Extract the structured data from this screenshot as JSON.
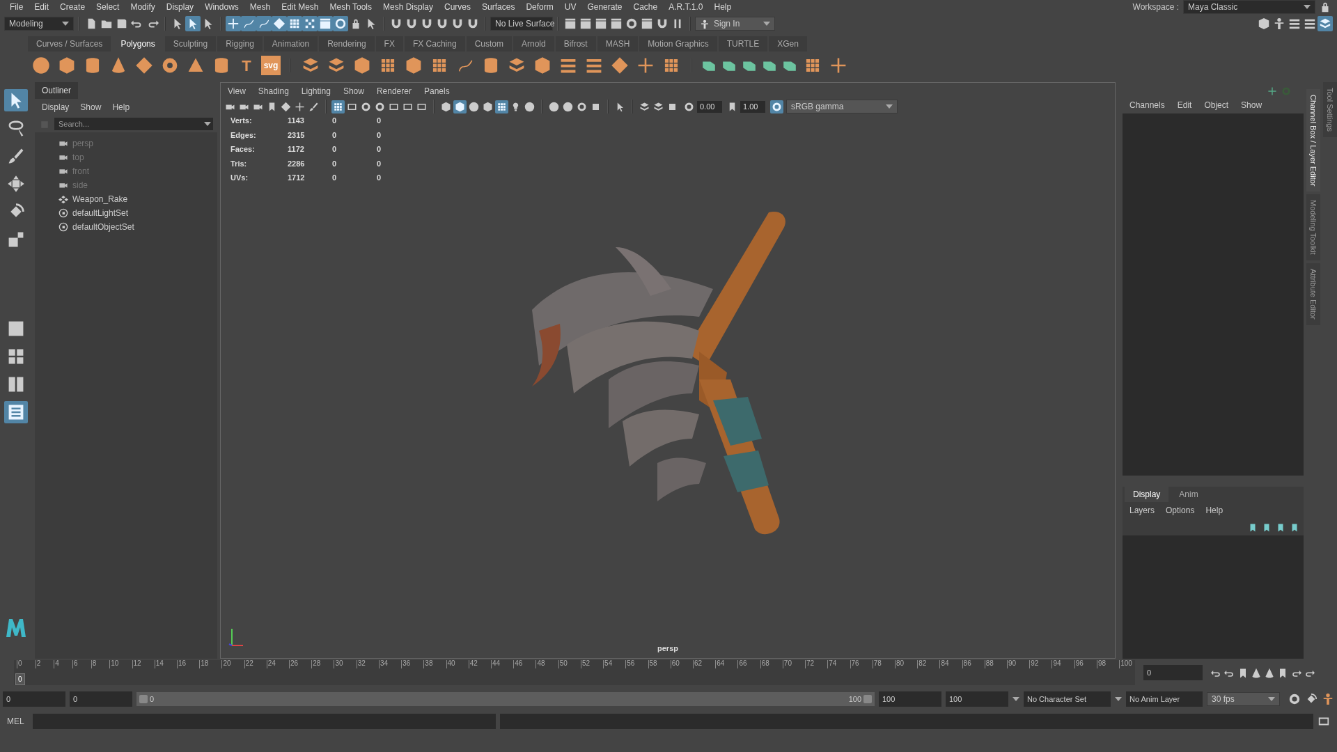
{
  "menu_bar": [
    "File",
    "Edit",
    "Create",
    "Select",
    "Modify",
    "Display",
    "Windows",
    "Mesh",
    "Edit Mesh",
    "Mesh Tools",
    "Mesh Display",
    "Curves",
    "Surfaces",
    "Deform",
    "UV",
    "Generate",
    "Cache",
    "A.R.T.1.0",
    "Help"
  ],
  "workspace": {
    "label": "Workspace :",
    "value": "Maya Classic"
  },
  "status_line": {
    "mode": "Modeling",
    "live_surface": "No Live Surface",
    "sign_in": "Sign In",
    "groups": [
      [
        {
          "kind": "page",
          "selected": false
        },
        {
          "kind": "folder",
          "selected": false
        },
        {
          "kind": "disk",
          "selected": false
        },
        {
          "kind": "undo",
          "selected": false
        },
        {
          "kind": "redo",
          "selected": false
        }
      ],
      [
        {
          "kind": "arrow",
          "selected": false
        },
        {
          "kind": "arrow",
          "selected": true
        },
        {
          "kind": "arrow",
          "selected": false
        }
      ],
      [
        {
          "kind": "cross",
          "selected": true
        },
        {
          "kind": "curve",
          "selected": true
        },
        {
          "kind": "curve",
          "selected": true
        },
        {
          "kind": "diamond",
          "selected": true
        },
        {
          "kind": "grid",
          "selected": true
        },
        {
          "kind": "dots",
          "selected": true
        },
        {
          "kind": "clapper",
          "selected": true
        },
        {
          "kind": "help",
          "selected": true
        },
        {
          "kind": "lock",
          "selected": false
        },
        {
          "kind": "arrow",
          "selected": false
        }
      ],
      [
        {
          "kind": "magnet",
          "selected": false
        },
        {
          "kind": "magnet",
          "selected": false
        },
        {
          "kind": "magnet",
          "selected": false
        },
        {
          "kind": "magnet",
          "selected": false
        },
        {
          "kind": "magnet",
          "selected": false
        },
        {
          "kind": "magnet",
          "selected": false
        }
      ]
    ],
    "render_icons": [
      {
        "kind": "clapper",
        "selected": false
      },
      {
        "kind": "clapper",
        "selected": false
      },
      {
        "kind": "clapper",
        "selected": false
      },
      {
        "kind": "clapper",
        "selected": false
      },
      {
        "kind": "circle",
        "selected": false
      },
      {
        "kind": "clapper",
        "selected": false
      },
      {
        "kind": "magnet",
        "selected": false
      },
      {
        "kind": "pause",
        "selected": false
      }
    ],
    "right_icons": [
      {
        "kind": "cube",
        "selected": false
      },
      {
        "kind": "person",
        "selected": false
      },
      {
        "kind": "list",
        "selected": false
      },
      {
        "kind": "list",
        "selected": false
      },
      {
        "kind": "layers",
        "selected": true
      }
    ]
  },
  "shelf_tabs": [
    {
      "label": "Curves / Surfaces",
      "selected": false
    },
    {
      "label": "Polygons",
      "selected": true
    },
    {
      "label": "Sculpting",
      "selected": false
    },
    {
      "label": "Rigging",
      "selected": false
    },
    {
      "label": "Animation",
      "selected": false
    },
    {
      "label": "Rendering",
      "selected": false
    },
    {
      "label": "FX",
      "selected": false
    },
    {
      "label": "FX Caching",
      "selected": false
    },
    {
      "label": "Custom",
      "selected": false
    },
    {
      "label": "Arnold",
      "selected": false
    },
    {
      "label": "Bifrost",
      "selected": false
    },
    {
      "label": "MASH",
      "selected": false
    },
    {
      "label": "Motion Graphics",
      "selected": false
    },
    {
      "label": "TURTLE",
      "selected": false
    },
    {
      "label": "XGen",
      "selected": false
    }
  ],
  "shelf_icons": [
    {
      "kind": "sphere"
    },
    {
      "kind": "cube"
    },
    {
      "kind": "cylinder"
    },
    {
      "kind": "cone"
    },
    {
      "kind": "diamond"
    },
    {
      "kind": "torus"
    },
    {
      "kind": "pyramid"
    },
    {
      "kind": "cylinder"
    },
    {
      "kind": "text",
      "text": "T"
    },
    {
      "kind": "text",
      "text": "svg"
    },
    {
      "kind": "gap"
    },
    {
      "kind": "layers"
    },
    {
      "kind": "layers"
    },
    {
      "kind": "cube"
    },
    {
      "kind": "grid"
    },
    {
      "kind": "cube"
    },
    {
      "kind": "grid"
    },
    {
      "kind": "curve"
    },
    {
      "kind": "cylinder"
    },
    {
      "kind": "layers"
    },
    {
      "kind": "cube"
    },
    {
      "kind": "list"
    },
    {
      "kind": "list"
    },
    {
      "kind": "diamond"
    },
    {
      "kind": "cross"
    },
    {
      "kind": "grid"
    },
    {
      "kind": "gap"
    },
    {
      "kind": "uv"
    },
    {
      "kind": "uv"
    },
    {
      "kind": "uv"
    },
    {
      "kind": "uv"
    },
    {
      "kind": "uv"
    },
    {
      "kind": "grid"
    },
    {
      "kind": "cross"
    }
  ],
  "tools": [
    {
      "kind": "arrow",
      "selected": true
    },
    {
      "kind": "lasso",
      "selected": false
    },
    {
      "kind": "brush",
      "selected": false
    },
    {
      "kind": "move",
      "selected": false
    },
    {
      "kind": "rotate",
      "selected": false
    },
    {
      "kind": "scale",
      "selected": false
    }
  ],
  "layouts": [
    {
      "kind": "single",
      "selected": false
    },
    {
      "kind": "quad",
      "selected": false
    },
    {
      "kind": "split",
      "selected": false
    },
    {
      "kind": "outliner",
      "selected": true
    }
  ],
  "outliner": {
    "title": "Outliner",
    "menu": [
      "Display",
      "Show",
      "Help"
    ],
    "search": {
      "placeholder": "Search..."
    },
    "items": [
      {
        "label": "persp",
        "kind": "camera",
        "dimmed": true
      },
      {
        "label": "top",
        "kind": "camera",
        "dimmed": true
      },
      {
        "label": "front",
        "kind": "camera",
        "dimmed": true
      },
      {
        "label": "side",
        "kind": "camera",
        "dimmed": true
      },
      {
        "label": "Weapon_Rake",
        "kind": "transform",
        "dimmed": false
      },
      {
        "label": "defaultLightSet",
        "kind": "set",
        "dimmed": false
      },
      {
        "label": "defaultObjectSet",
        "kind": "set",
        "dimmed": false
      }
    ]
  },
  "viewport": {
    "menu": [
      "View",
      "Shading",
      "Lighting",
      "Show",
      "Renderer",
      "Panels"
    ],
    "toolbar": [
      {
        "kind": "camera",
        "selected": false
      },
      {
        "kind": "camera",
        "selected": false
      },
      {
        "kind": "camera",
        "selected": false
      },
      {
        "kind": "bookmark",
        "selected": false
      },
      {
        "kind": "diamond",
        "selected": false
      },
      {
        "kind": "cross",
        "selected": false
      },
      {
        "kind": "brush",
        "selected": false
      },
      {
        "kind": "sep"
      },
      {
        "kind": "grid",
        "selected": true
      },
      {
        "kind": "film",
        "selected": false
      },
      {
        "kind": "circle",
        "selected": false
      },
      {
        "kind": "circle",
        "selected": false
      },
      {
        "kind": "film",
        "selected": false
      },
      {
        "kind": "film",
        "selected": false
      },
      {
        "kind": "film",
        "selected": false
      },
      {
        "kind": "sep"
      },
      {
        "kind": "cube",
        "selected": false
      },
      {
        "kind": "cube",
        "selected": true
      },
      {
        "kind": "sphere",
        "selected": false
      },
      {
        "kind": "cube",
        "selected": false
      },
      {
        "kind": "grid",
        "selected": true
      },
      {
        "kind": "bulb",
        "selected": false
      },
      {
        "kind": "sphere",
        "selected": false
      },
      {
        "kind": "sep"
      },
      {
        "kind": "sphere",
        "selected": false
      },
      {
        "kind": "sphere",
        "selected": false
      },
      {
        "kind": "circle",
        "selected": false
      },
      {
        "kind": "square",
        "selected": false
      },
      {
        "kind": "sep"
      },
      {
        "kind": "arrow",
        "selected": false
      },
      {
        "kind": "sep"
      },
      {
        "kind": "layers",
        "selected": false
      },
      {
        "kind": "layers",
        "selected": false
      },
      {
        "kind": "square",
        "selected": false
      }
    ],
    "exposure": "0.00",
    "gamma": "1.00",
    "color_space": "sRGB gamma",
    "hud": [
      {
        "label": "Verts:",
        "values": [
          "1143",
          "0",
          "0"
        ]
      },
      {
        "label": "Edges:",
        "values": [
          "2315",
          "0",
          "0"
        ]
      },
      {
        "label": "Faces:",
        "values": [
          "1172",
          "0",
          "0"
        ]
      },
      {
        "label": "Tris:",
        "values": [
          "2286",
          "0",
          "0"
        ]
      },
      {
        "label": "UVs:",
        "values": [
          "1712",
          "0",
          "0"
        ]
      }
    ],
    "camera": "persp",
    "model": {
      "kind": "picture"
    }
  },
  "channel_box": {
    "menu": [
      "Channels",
      "Edit",
      "Object",
      "Show"
    ]
  },
  "layer_editor": {
    "tabs": [
      {
        "label": "Display",
        "selected": true
      },
      {
        "label": "Anim",
        "selected": false
      }
    ],
    "menu": [
      "Layers",
      "Options",
      "Help"
    ]
  },
  "side_tabs": [
    {
      "label": "Channel Box / Layer Editor",
      "selected": true
    },
    {
      "label": "Modeling Toolkit",
      "selected": false
    },
    {
      "label": "Attribute Editor",
      "selected": false
    }
  ],
  "side_tabs_2": [
    {
      "label": "Tool Settings",
      "selected": false
    }
  ],
  "timeline": {
    "ticks": [
      "0",
      "2",
      "4",
      "6",
      "8",
      "10",
      "12",
      "14",
      "16",
      "18",
      "20",
      "22",
      "24",
      "26",
      "28",
      "30",
      "32",
      "34",
      "36",
      "38",
      "40",
      "42",
      "44",
      "46",
      "48",
      "50",
      "52",
      "54",
      "56",
      "58",
      "60",
      "62",
      "64",
      "66",
      "68",
      "70",
      "72",
      "74",
      "76",
      "78",
      "80",
      "82",
      "84",
      "86",
      "88",
      "90",
      "92",
      "94",
      "96",
      "98",
      "100"
    ],
    "current": "0",
    "frame_field": "0"
  },
  "range": {
    "level": 1,
    "start": "0",
    "playback_start": "0",
    "slider_start": "0",
    "slider_end": "100",
    "playback_end": "100",
    "end": "100",
    "character_set": "No Character Set",
    "anim_layer": "No Anim Layer",
    "fps": "30 fps"
  },
  "command_line": {
    "label": "MEL"
  }
}
